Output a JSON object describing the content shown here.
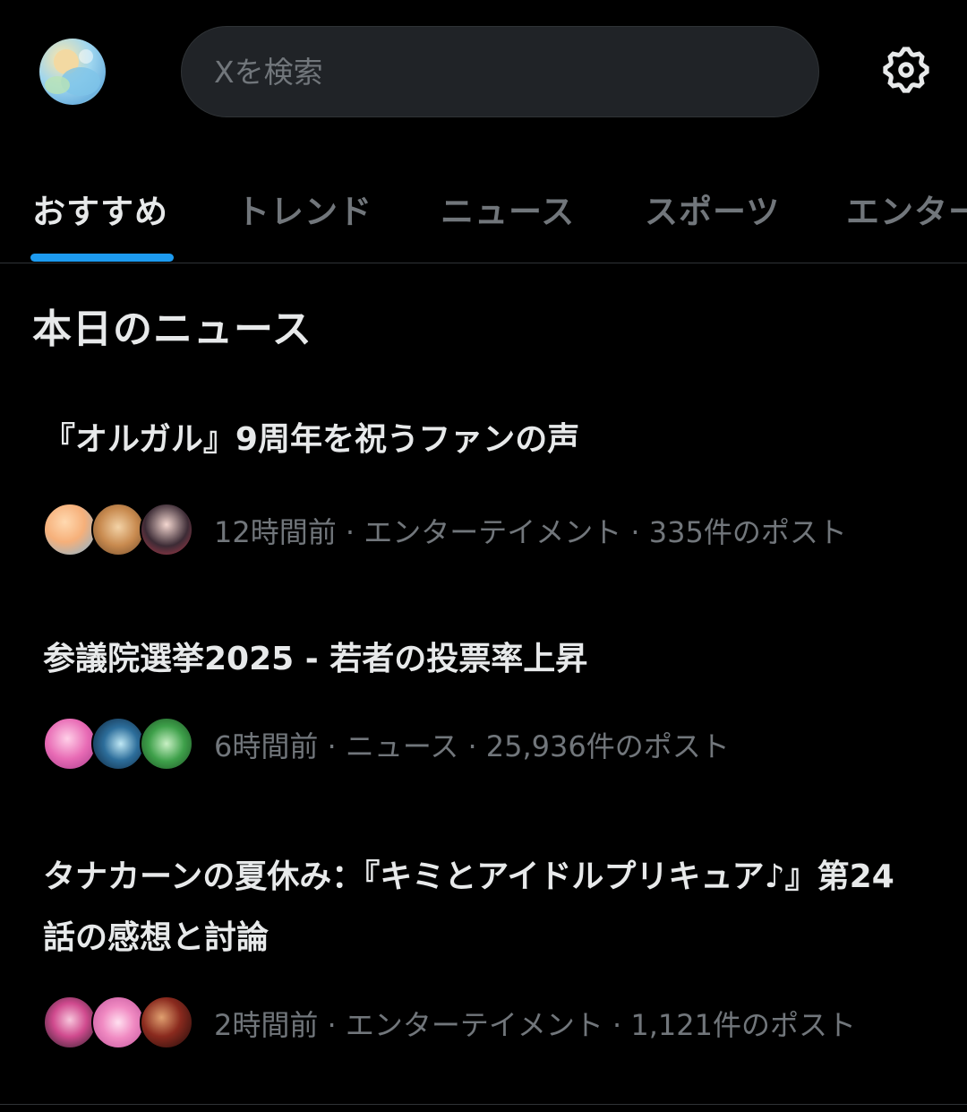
{
  "search": {
    "placeholder": "Xを検索"
  },
  "tabs": [
    {
      "label": "おすすめ",
      "active": true
    },
    {
      "label": "トレンド",
      "active": false
    },
    {
      "label": "ニュース",
      "active": false
    },
    {
      "label": "スポーツ",
      "active": false
    },
    {
      "label": "エンターテイメント",
      "active": false
    }
  ],
  "section": {
    "title": "本日のニュース"
  },
  "news": [
    {
      "title": "『オルガル』9周年を祝うファンの声",
      "meta": "12時間前 · エンターテイメント · 335件のポスト"
    },
    {
      "title": "参議院選挙2025 - 若者の投票率上昇",
      "meta": "6時間前 · ニュース · 25,936件のポスト"
    },
    {
      "title": "タナカーンの夏休み：『キミとアイドルプリキュア♪』第24話の感想と討論",
      "meta": "2時間前 · エンターテイメント · 1,121件のポスト"
    }
  ],
  "colors": {
    "background": "#000000",
    "text_primary": "#e7e9ea",
    "text_secondary": "#71767b",
    "accent": "#1d9bf0",
    "search_bg": "#202327",
    "divider": "#2f3336"
  },
  "icons": {
    "settings": "gear-icon"
  }
}
